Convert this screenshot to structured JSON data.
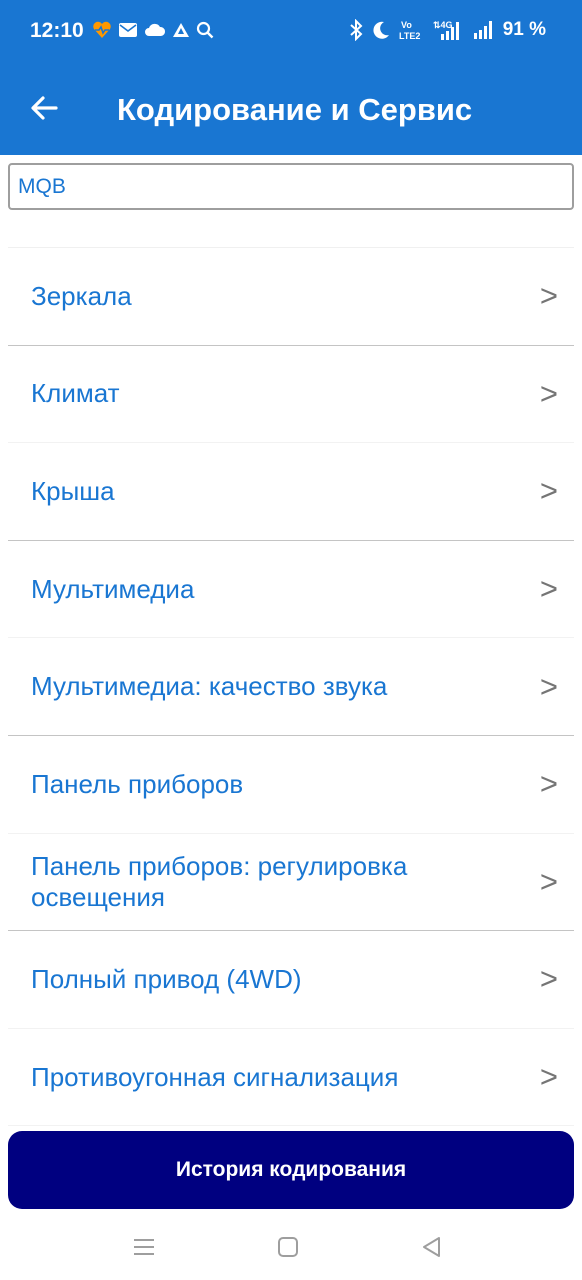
{
  "status_bar": {
    "time": "12:10",
    "battery": "91 %",
    "left_icons": [
      "heart-pulse-icon",
      "mail-icon",
      "cloud-icon",
      "a-triangle-icon",
      "search-icon"
    ],
    "right_icons": [
      "bluetooth-icon",
      "moon-icon",
      "volte-icon",
      "signal-4g-icon",
      "signal-icon"
    ],
    "volte_text": "Vo\nLTE2",
    "network_text": "4G"
  },
  "app_bar": {
    "title": "Кодирование и Сервис"
  },
  "search": {
    "value": "MQB"
  },
  "list": {
    "items": [
      {
        "label": "Зеркала"
      },
      {
        "label": "Климат"
      },
      {
        "label": "Крыша"
      },
      {
        "label": "Мультимедиа"
      },
      {
        "label": "Мультимедиа: качество звука"
      },
      {
        "label": "Панель приборов"
      },
      {
        "label": "Панель приборов: регулировка освещения"
      },
      {
        "label": "Полный привод (4WD)"
      },
      {
        "label": "Противоугонная сигнализация"
      }
    ],
    "chevron": ">"
  },
  "history_button": {
    "label": "История кодирования"
  },
  "colors": {
    "primary": "#1976d2",
    "button": "#000080"
  }
}
